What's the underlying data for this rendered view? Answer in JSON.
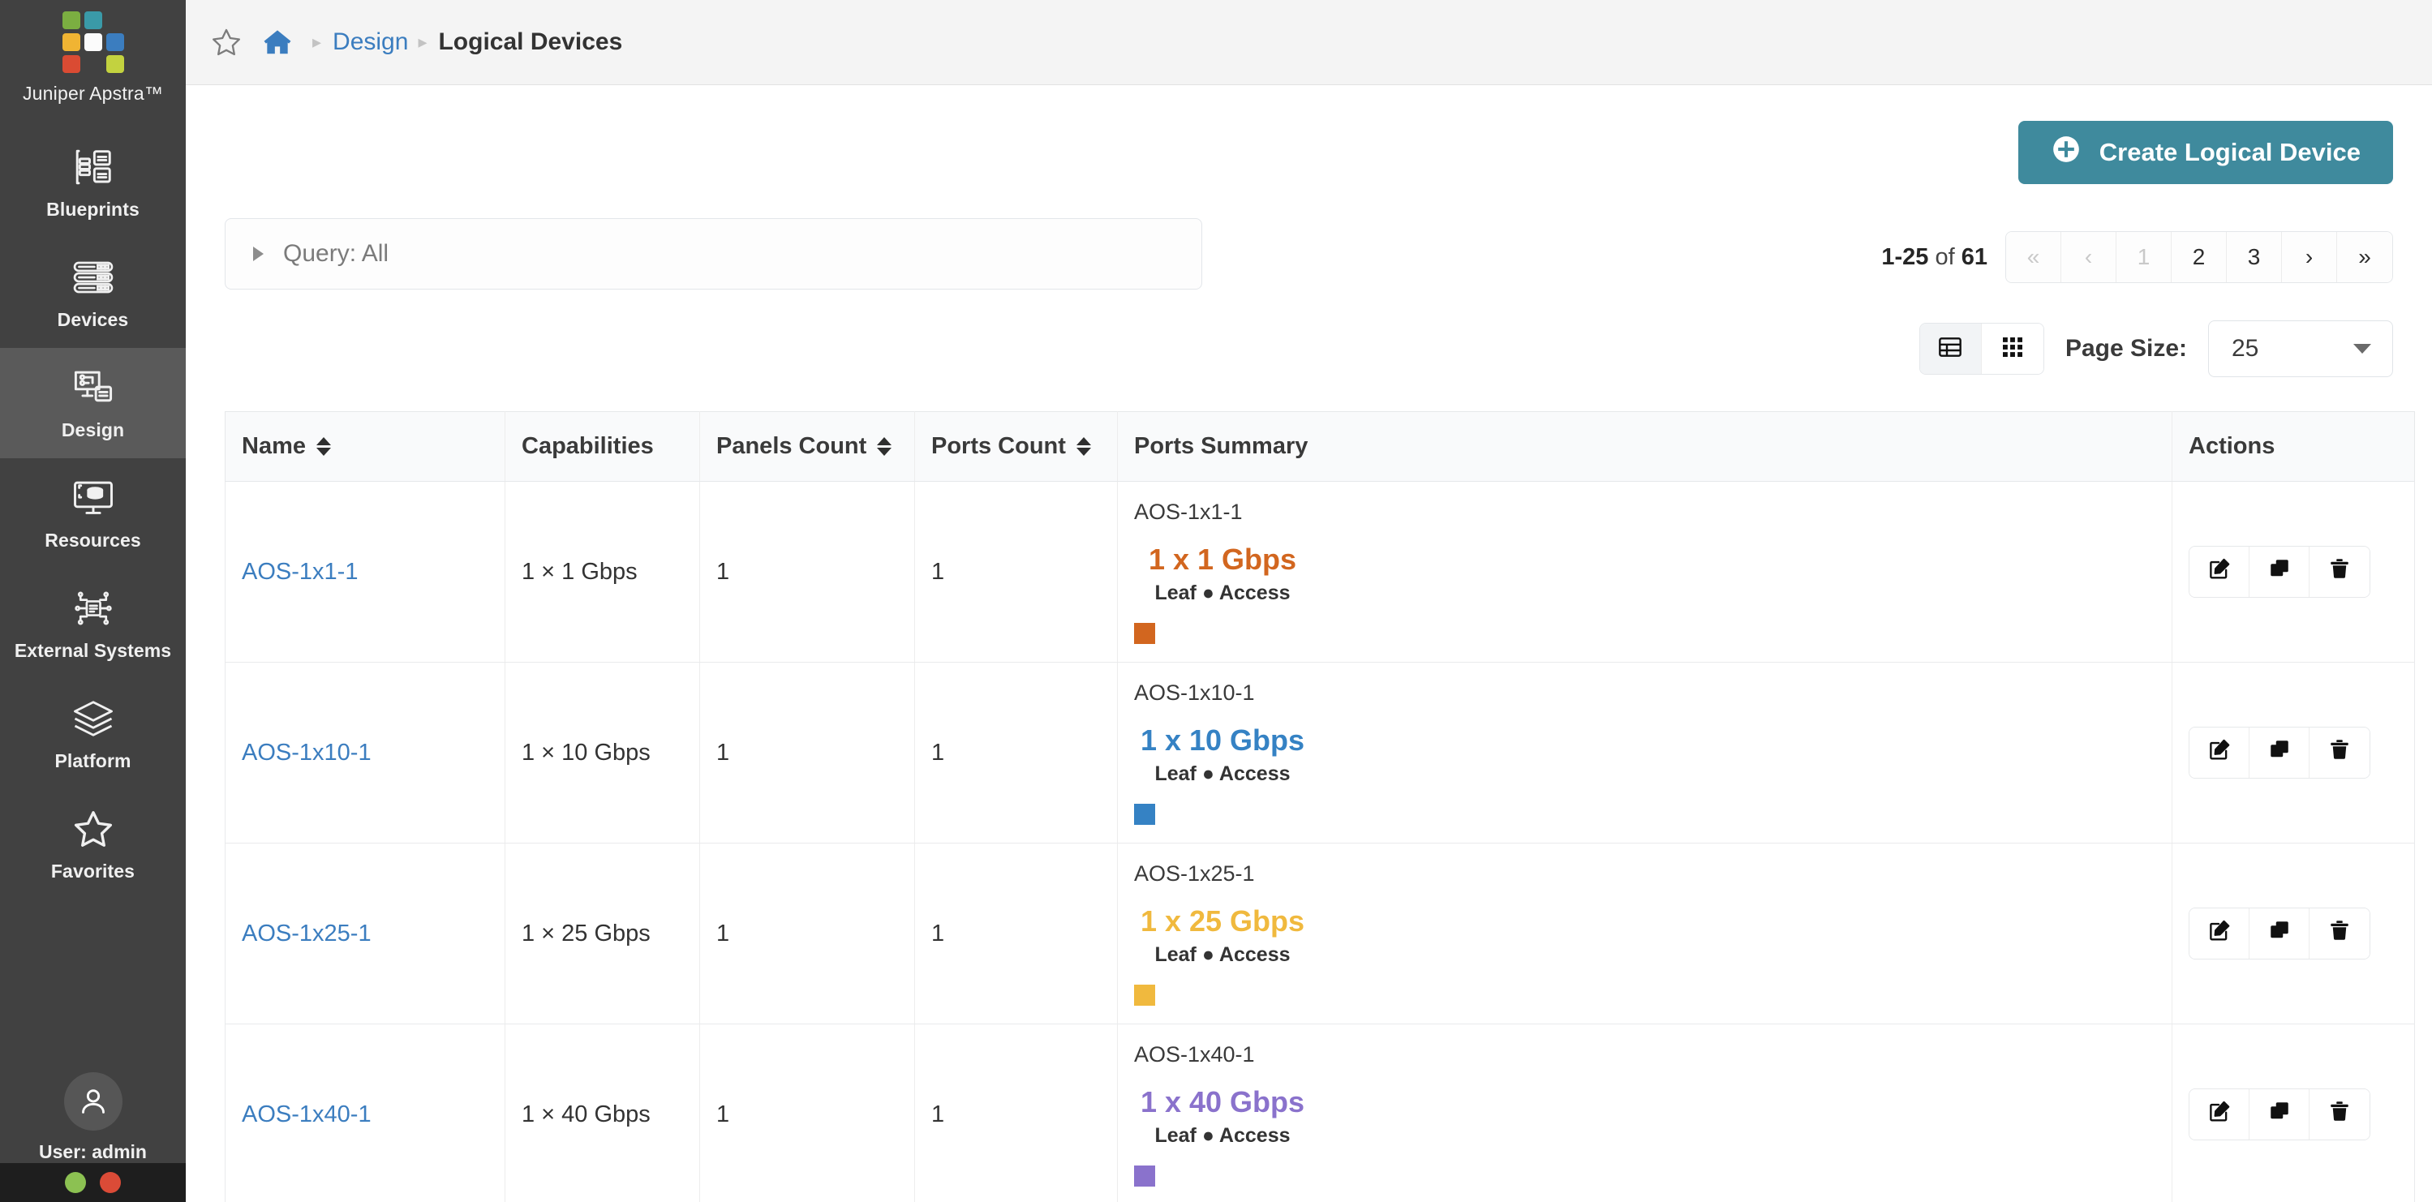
{
  "sidebar": {
    "brand": "Juniper Apstra™",
    "logo_colors": [
      "#7bae41",
      "#3a9aa8",
      "",
      "#f0b433",
      "#fbfbfb",
      "#3b7dbf",
      "#da4b33",
      "",
      "#c3d23f"
    ],
    "items": [
      {
        "label": "Blueprints",
        "icon": "blueprints-icon",
        "active": false
      },
      {
        "label": "Devices",
        "icon": "devices-icon",
        "active": false
      },
      {
        "label": "Design",
        "icon": "design-icon",
        "active": true
      },
      {
        "label": "Resources",
        "icon": "resources-icon",
        "active": false
      },
      {
        "label": "External Systems",
        "icon": "external-systems-icon",
        "active": false
      },
      {
        "label": "Platform",
        "icon": "platform-icon",
        "active": false
      },
      {
        "label": "Favorites",
        "icon": "favorites-star-icon",
        "active": false
      }
    ],
    "user": {
      "label": "User: admin",
      "icon": "user-avatar-icon"
    },
    "status_dots": [
      "#8cc152",
      "#db4b37"
    ]
  },
  "breadcrumb": {
    "star_icon": "star-outline-icon",
    "home_icon": "home-icon",
    "separator": "▸",
    "parent": "Design",
    "current": "Logical Devices"
  },
  "toolbar": {
    "create_label": "Create Logical Device",
    "create_icon": "plus-circle-icon",
    "create_color": "#3f8a9d"
  },
  "filter": {
    "caret": "▸",
    "query_label": "Query: All"
  },
  "pagination": {
    "range_start": "1-25",
    "of": "of",
    "total": "61",
    "buttons": [
      {
        "label": "«",
        "name": "first-page-button",
        "dim": true
      },
      {
        "label": "‹",
        "name": "prev-page-button",
        "dim": true
      },
      {
        "label": "1",
        "name": "page-1-button",
        "dim": true
      },
      {
        "label": "2",
        "name": "page-2-button",
        "dim": false
      },
      {
        "label": "3",
        "name": "page-3-button",
        "dim": false
      },
      {
        "label": "›",
        "name": "next-page-button",
        "dim": false
      },
      {
        "label": "»",
        "name": "last-page-button",
        "dim": false
      }
    ]
  },
  "view": {
    "table_icon": "table-view-icon",
    "grid_icon": "grid-view-icon",
    "page_size_label": "Page Size:",
    "page_size_value": "25"
  },
  "table": {
    "columns": [
      {
        "label": "Name",
        "sortable": true
      },
      {
        "label": "Capabilities",
        "sortable": false
      },
      {
        "label": "Panels Count",
        "sortable": true
      },
      {
        "label": "Ports Count",
        "sortable": true
      },
      {
        "label": "Ports Summary",
        "sortable": false
      },
      {
        "label": "Actions",
        "sortable": false
      }
    ],
    "actions": [
      {
        "name": "edit-button",
        "icon": "edit-pencil-icon"
      },
      {
        "name": "clone-button",
        "icon": "copy-icon"
      },
      {
        "name": "delete-button",
        "icon": "trash-icon"
      }
    ],
    "rows": [
      {
        "name": "AOS-1x1-1",
        "capabilities": "1 × 1 Gbps",
        "panels_count": "1",
        "ports_count": "1",
        "summary_name": "AOS-1x1-1",
        "summary_speed": "1 x 1 Gbps",
        "summary_roles": "Leaf ● Access",
        "summary_color": "#d2661f"
      },
      {
        "name": "AOS-1x10-1",
        "capabilities": "1 × 10 Gbps",
        "panels_count": "1",
        "ports_count": "1",
        "summary_name": "AOS-1x10-1",
        "summary_speed": "1 x 10 Gbps",
        "summary_roles": "Leaf ● Access",
        "summary_color": "#3582c4"
      },
      {
        "name": "AOS-1x25-1",
        "capabilities": "1 × 25 Gbps",
        "panels_count": "1",
        "ports_count": "1",
        "summary_name": "AOS-1x25-1",
        "summary_speed": "1 x 25 Gbps",
        "summary_roles": "Leaf ● Access",
        "summary_color": "#f0b93e"
      },
      {
        "name": "AOS-1x40-1",
        "capabilities": "1 × 40 Gbps",
        "panels_count": "1",
        "ports_count": "1",
        "summary_name": "AOS-1x40-1",
        "summary_speed": "1 x 40 Gbps",
        "summary_roles": "Leaf ● Access",
        "summary_color": "#8a72cc"
      }
    ]
  }
}
